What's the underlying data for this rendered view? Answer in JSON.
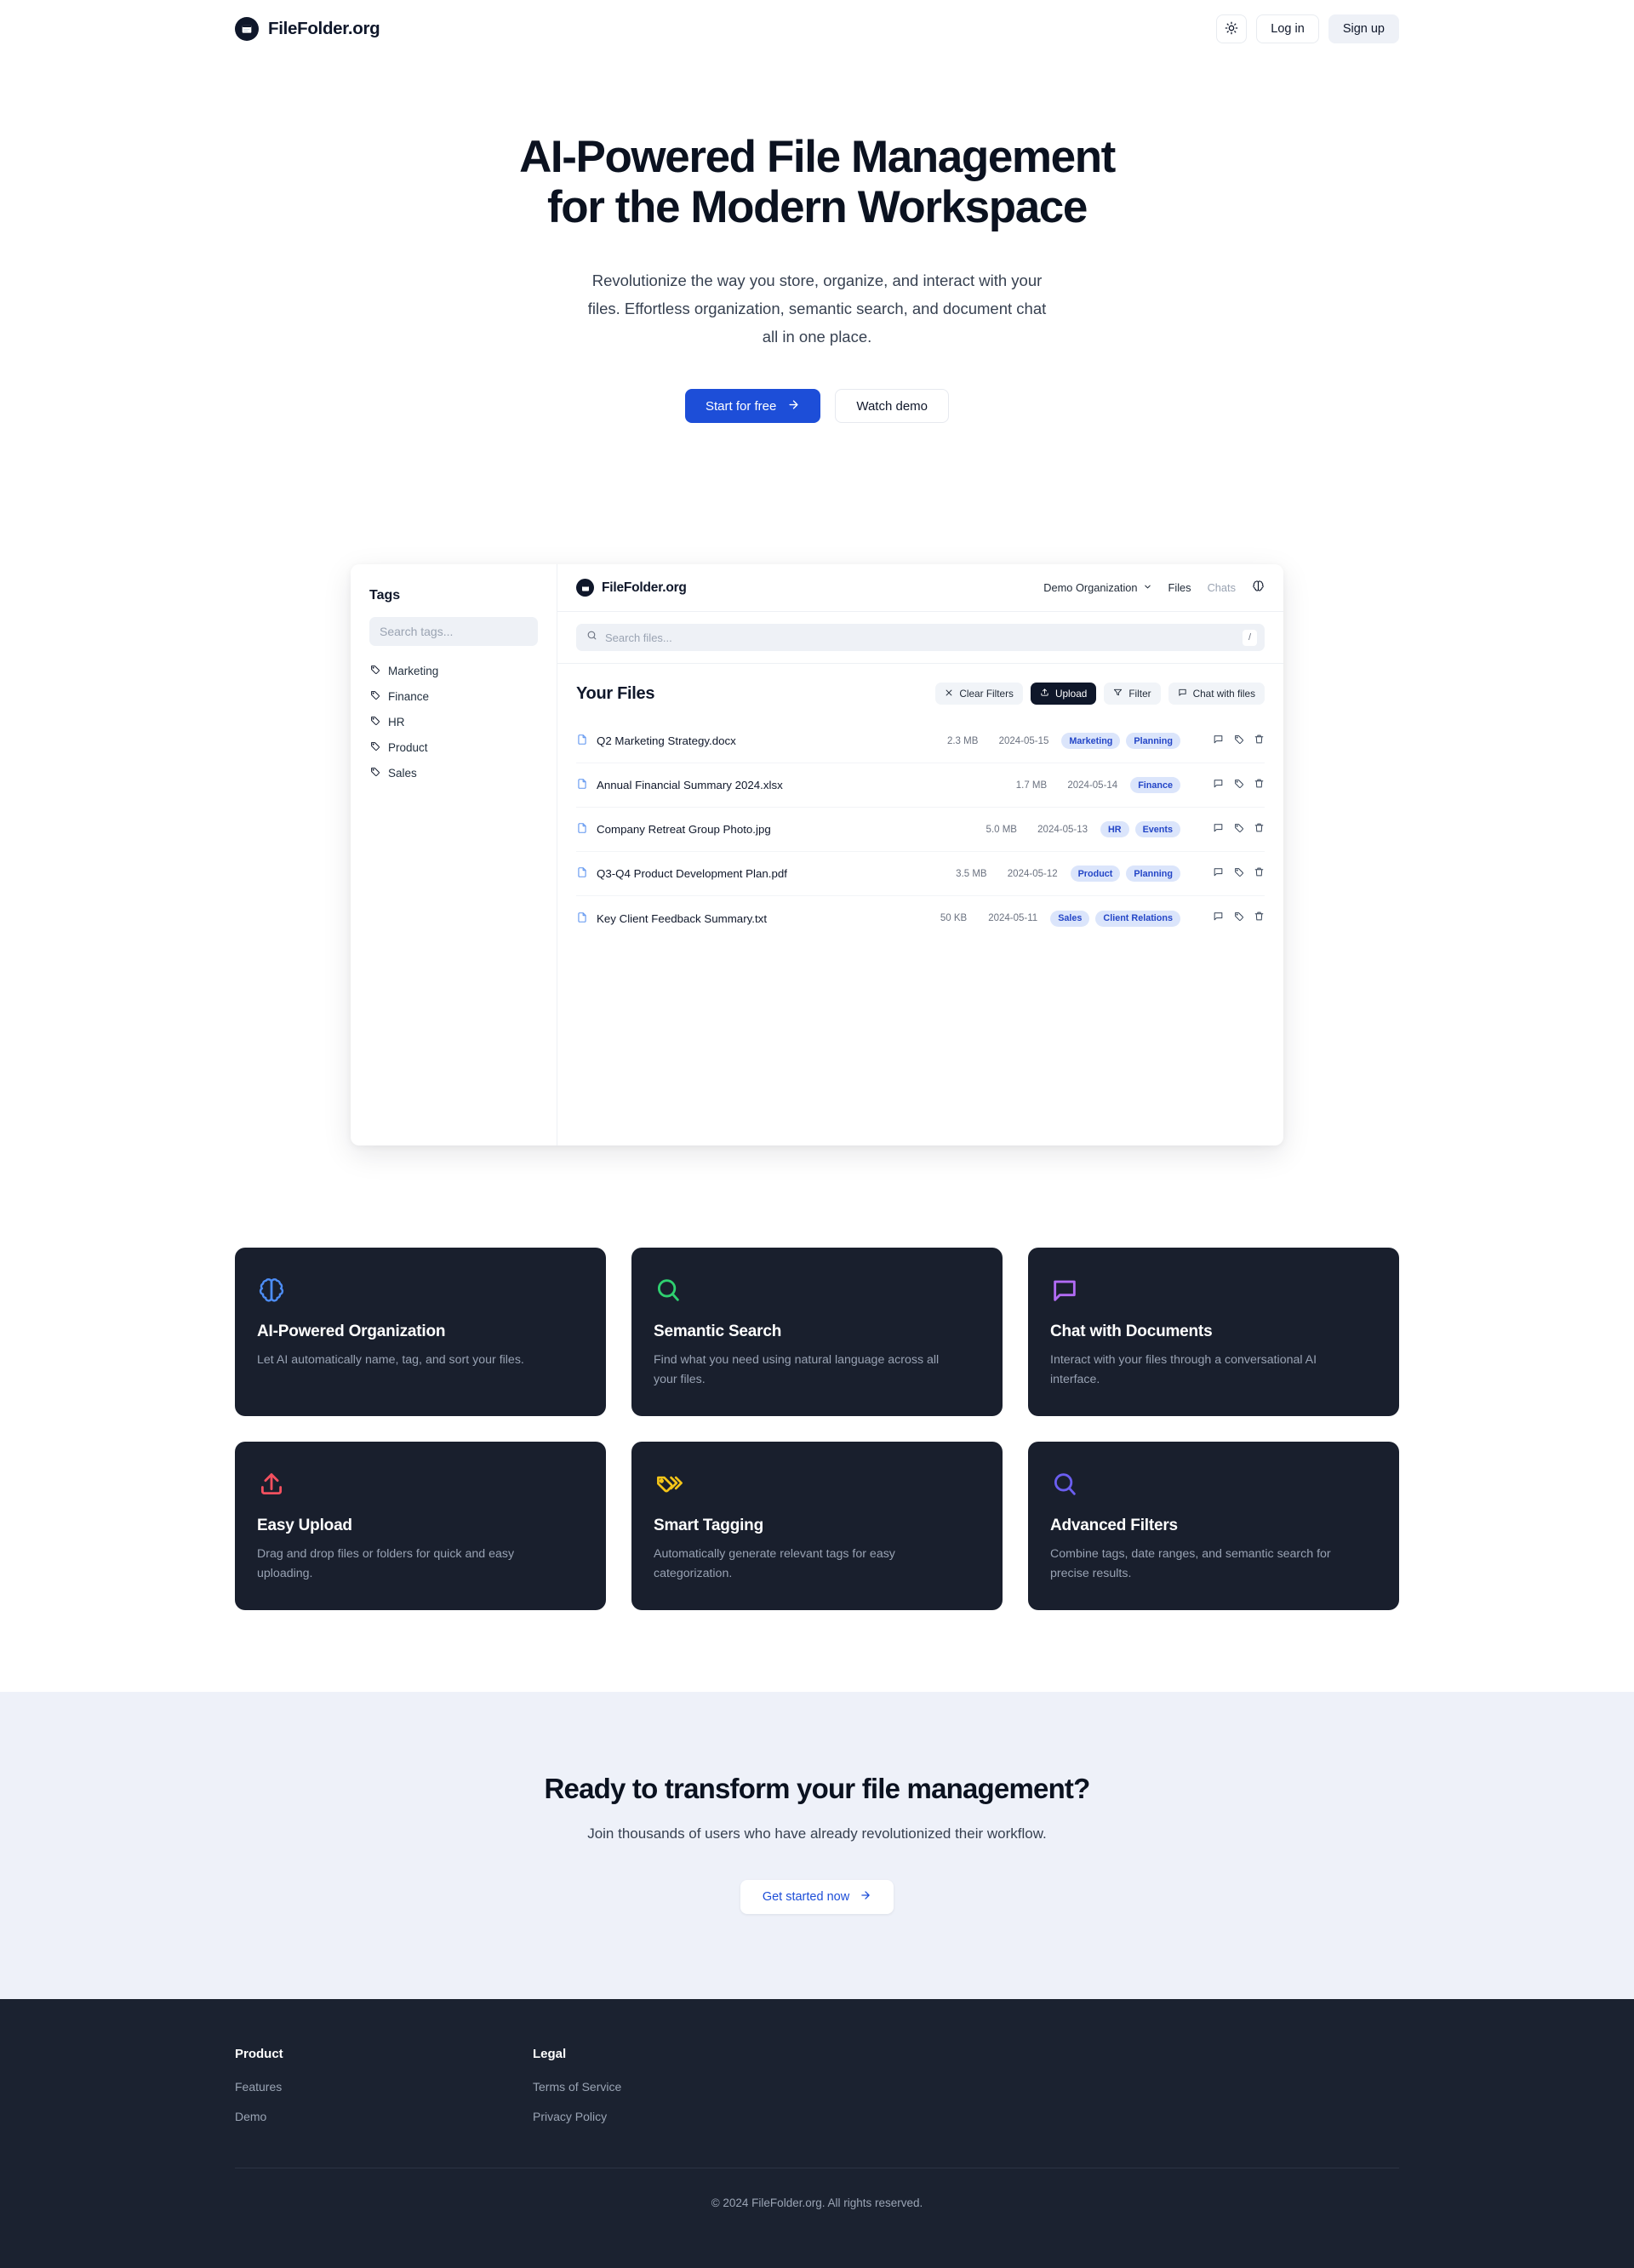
{
  "brand": {
    "name": "FileFolder.org",
    "logo_icon": "folder-window-icon"
  },
  "topnav": {
    "theme_toggle_icon": "sun-icon",
    "login_label": "Log in",
    "signup_label": "Sign up"
  },
  "hero": {
    "title_line1": "AI-Powered File Management",
    "title_line2": "for the Modern Workspace",
    "subtitle_line1": "Revolutionize the way you store, organize, and interact with your",
    "subtitle_line2": "files. Effortless organization, semantic search, and document chat",
    "subtitle_line3": "all in one place.",
    "primary_cta": "Start for free",
    "primary_cta_icon": "arrow-right-icon",
    "secondary_cta": "Watch demo"
  },
  "preview": {
    "tags_panel": {
      "title": "Tags",
      "search_placeholder": "Search tags...",
      "tags": [
        {
          "label": "Marketing"
        },
        {
          "label": "Finance"
        },
        {
          "label": "HR"
        },
        {
          "label": "Product"
        },
        {
          "label": "Sales"
        }
      ]
    },
    "app_header": {
      "brand": "FileFolder.org",
      "org_name": "Demo Organization",
      "org_chevron_icon": "chevron-down-icon",
      "nav_files": "Files",
      "nav_chats": "Chats",
      "brain_icon": "brain-icon"
    },
    "search": {
      "placeholder": "Search files...",
      "search_icon": "search-icon",
      "shortcut_key": "/"
    },
    "files": {
      "heading": "Your Files",
      "actions": {
        "clear_filters": "Clear Filters",
        "upload": "Upload",
        "filter": "Filter",
        "chat_with_files": "Chat with files"
      },
      "rows": [
        {
          "name": "Q2 Marketing Strategy.docx",
          "size": "2.3 MB",
          "date": "2024-05-15",
          "tags": [
            "Marketing",
            "Planning"
          ]
        },
        {
          "name": "Annual Financial Summary 2024.xlsx",
          "size": "1.7 MB",
          "date": "2024-05-14",
          "tags": [
            "Finance"
          ]
        },
        {
          "name": "Company Retreat Group Photo.jpg",
          "size": "5.0 MB",
          "date": "2024-05-13",
          "tags": [
            "HR",
            "Events"
          ]
        },
        {
          "name": "Q3-Q4 Product Development Plan.pdf",
          "size": "3.5 MB",
          "date": "2024-05-12",
          "tags": [
            "Product",
            "Planning"
          ]
        },
        {
          "name": "Key Client Feedback Summary.txt",
          "size": "50 KB",
          "date": "2024-05-11",
          "tags": [
            "Sales",
            "Client Relations"
          ]
        }
      ]
    }
  },
  "features": [
    {
      "icon": "brain-icon",
      "color": "#4d8df6",
      "title": "AI-Powered Organization",
      "desc": "Let AI automatically name, tag, and sort your files."
    },
    {
      "icon": "search-icon",
      "color": "#2fd070",
      "title": "Semantic Search",
      "desc": "Find what you need using natural language across all your files."
    },
    {
      "icon": "chat-bubble-icon",
      "color": "#b26bf5",
      "title": "Chat with Documents",
      "desc": "Interact with your files through a conversational AI interface."
    },
    {
      "icon": "upload-icon",
      "color": "#f4505f",
      "title": "Easy Upload",
      "desc": "Drag and drop files or folders for quick and easy uploading."
    },
    {
      "icon": "tags-icon",
      "color": "#f5c518",
      "title": "Smart Tagging",
      "desc": "Automatically generate relevant tags for easy categorization."
    },
    {
      "icon": "search-icon",
      "color": "#6b5ef0",
      "title": "Advanced Filters",
      "desc": "Combine tags, date ranges, and semantic search for precise results."
    }
  ],
  "cta": {
    "title": "Ready to transform your file management?",
    "subtitle": "Join thousands of users who have already revolutionized their workflow.",
    "button": "Get started now",
    "button_icon": "arrow-right-icon"
  },
  "footer": {
    "columns": [
      {
        "title": "Product",
        "links": [
          "Features",
          "Demo"
        ]
      },
      {
        "title": "Legal",
        "links": [
          "Terms of Service",
          "Privacy Policy"
        ]
      }
    ],
    "copyright": "© 2024 FileFolder.org. All rights reserved."
  },
  "colors": {
    "accent_blue": "#1d4ed8",
    "badge_bg": "#dbe5fb",
    "badge_text": "#2446c7",
    "dark_card": "#191f2d",
    "footer_bg": "#1b2230",
    "cta_bg": "#eef1f9"
  }
}
